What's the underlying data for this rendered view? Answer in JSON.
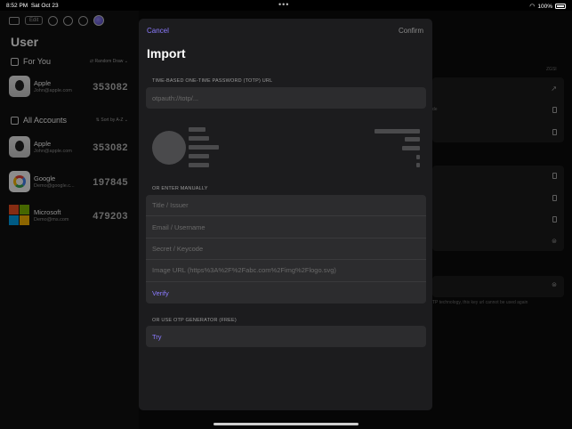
{
  "status_bar": {
    "time": "8:52 PM",
    "date": "Sat Oct 23",
    "battery": "100%"
  },
  "sidebar": {
    "edit_label": "Edit",
    "title": "User",
    "for_you": {
      "label": "For You",
      "sort": "Random Draw"
    },
    "featured": [
      {
        "name": "Apple",
        "email": "John@apple.com",
        "code": "353082",
        "logo": "apple-logo-icon"
      }
    ],
    "all_accounts": {
      "label": "All Accounts",
      "sort": "Sort by A-Z"
    },
    "accounts": [
      {
        "name": "Apple",
        "email": "John@apple.com",
        "code": "353082",
        "logo": "apple-logo-icon"
      },
      {
        "name": "Google",
        "email": "Demo@google.c...",
        "code": "197845",
        "logo": "google-logo-icon"
      },
      {
        "name": "Microsoft",
        "email": "Demo@ms.com",
        "code": "479203",
        "logo": "microsoft-logo-icon"
      }
    ]
  },
  "background_detail": {
    "header_fragment": "ZGSI",
    "row_fragment": "de",
    "footnote": "TP technology, this key url cannot be used again"
  },
  "modal": {
    "cancel_label": "Cancel",
    "confirm_label": "Confirm",
    "title": "Import",
    "totp_section_label": "TIME-BASED ONE-TIME PASSWORD (TOTP) URL",
    "totp_placeholder": "otpauth://totp/...",
    "manual_section_label": "OR ENTER MANUALLY",
    "fields": {
      "issuer_placeholder": "Title / Issuer",
      "username_placeholder": "Email / Username",
      "secret_placeholder": "Secret / Keycode",
      "image_placeholder": "Image URL (https%3A%2F%2Fabc.com%2Fimg%2Flogo.svg)"
    },
    "verify_label": "Verify",
    "generator_section_label": "OR USE OTP GENERATOR (FREE)",
    "try_label": "Try"
  },
  "colors": {
    "accent": "#8b7bff",
    "modal_bg": "#1c1c1e",
    "field_bg": "#2c2c2e"
  }
}
